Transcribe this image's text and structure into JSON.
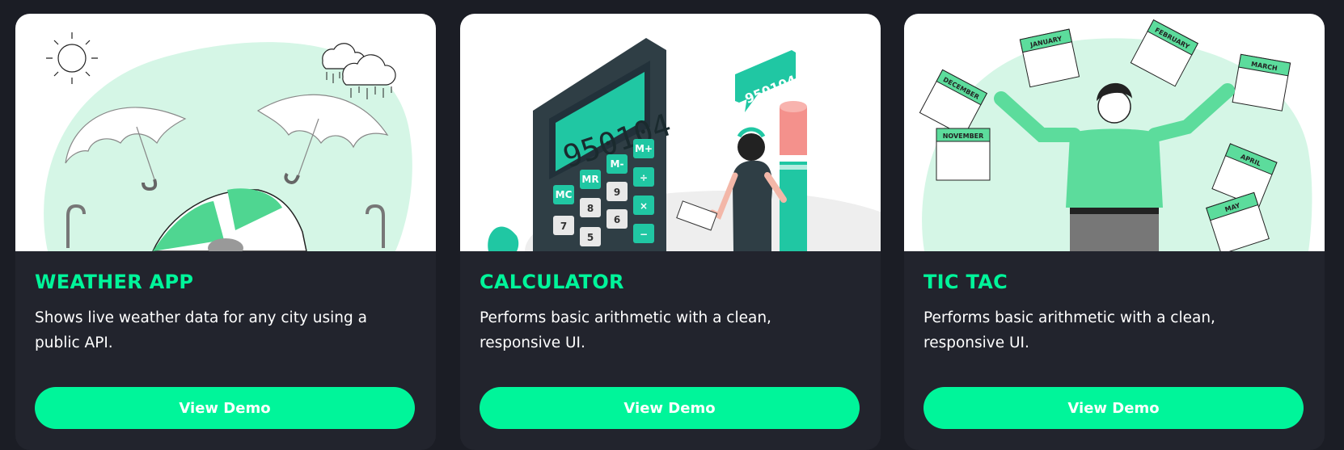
{
  "projects": [
    {
      "title": "WEATHER APP",
      "description": "Shows live weather data for any city using a public API.",
      "button_label": "View Demo",
      "illustration": "weather-illustration"
    },
    {
      "title": "CALCULATOR",
      "description": "Performs basic arithmetic with a clean, responsive UI.",
      "button_label": "View Demo",
      "illustration": "calculator-illustration",
      "display_value": "950104",
      "speech_bubble": "950104+...",
      "keys": [
        "MC",
        "MR",
        "M-",
        "M+",
        "9",
        "8",
        "7",
        "6",
        "5",
        "÷",
        "×",
        "−"
      ]
    },
    {
      "title": "TIC TAC",
      "description": "Performs basic arithmetic with a clean, responsive UI.",
      "button_label": "View Demo",
      "illustration": "calendar-celebration-illustration",
      "calendar_months": [
        "JANUARY",
        "FEBRUARY",
        "MARCH",
        "DECEMBER",
        "NOVEMBER",
        "APRIL",
        "MAY"
      ]
    }
  ],
  "colors": {
    "accent": "#00f59a",
    "background": "#1b1d25",
    "card": "#22242d",
    "illustration_green": "#5cdc9c",
    "illustration_teal": "#20c7a3",
    "illustration_dark": "#2f3e45"
  }
}
